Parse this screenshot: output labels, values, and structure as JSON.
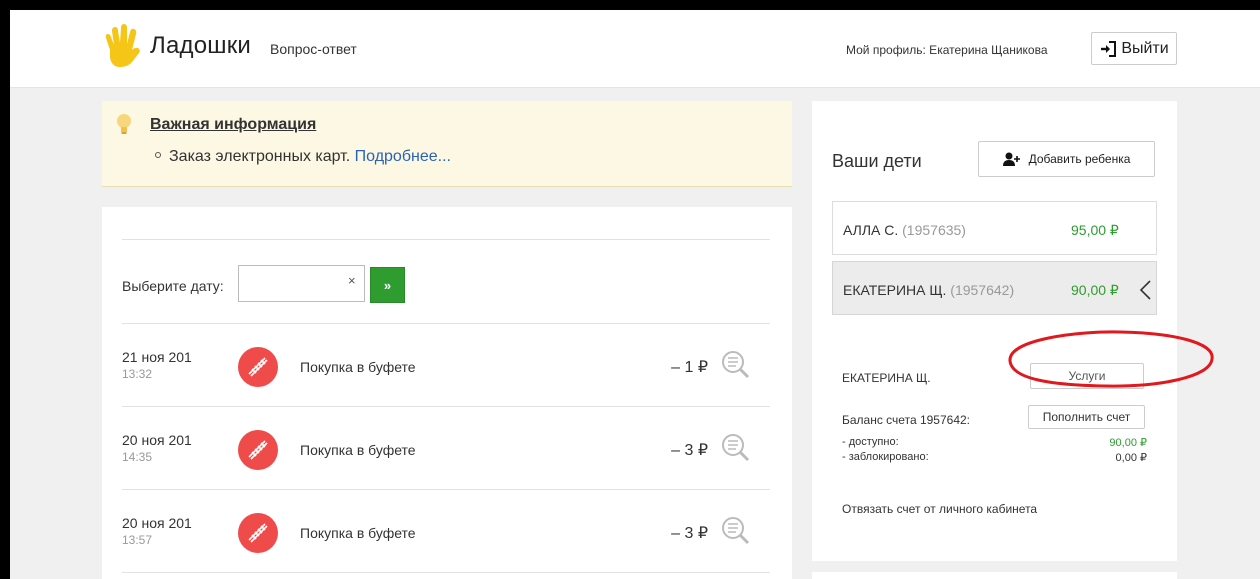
{
  "header": {
    "logo_text": "Ладошки",
    "nav_faq": "Вопрос-ответ",
    "profile_label": "Мой профиль: Екатерина Щаникова",
    "logout_label": "Выйти"
  },
  "notice": {
    "title": "Важная информация",
    "item_text": "Заказ электронных карт.",
    "item_link": "Подробнее..."
  },
  "feed": {
    "date_label": "Выберите дату:",
    "date_value": "",
    "clear_glyph": "×",
    "go_glyph": "»",
    "rows": [
      {
        "date": "21 ноя 201",
        "time": "13:32",
        "desc": "Покупка в буфете",
        "amount": "– 1 ₽"
      },
      {
        "date": "20 ноя 201",
        "time": "14:35",
        "desc": "Покупка в буфете",
        "amount": "– 3 ₽"
      },
      {
        "date": "20 ноя 201",
        "time": "13:57",
        "desc": "Покупка в буфете",
        "amount": "– 3 ₽"
      }
    ]
  },
  "sidebar": {
    "title": "Ваши дети",
    "add_child_label": "Добавить ребенка",
    "children": [
      {
        "name": "Алла С.",
        "account": "(1957635)",
        "balance": "95,00 ₽",
        "active": false
      },
      {
        "name": "Екатерина Щ.",
        "account": "(1957642)",
        "balance": "90,00 ₽",
        "active": true
      }
    ],
    "selected_name": "ЕКАТЕРИНА Щ.",
    "services_label": "Услуги",
    "balance_label": "Баланс счета 1957642:",
    "topup_label": "Пополнить счет",
    "available_label": "- доступно:",
    "available_value": "90,00 ₽",
    "blocked_label": "- заблокировано:",
    "blocked_value": "0,00 ₽",
    "unlink_label": "Отвязать счет от личного кабинета"
  },
  "colors": {
    "accent_green": "#2e9c2e",
    "notice_bg": "#fcf8e3",
    "link_blue": "#2a62b8",
    "badge_red": "#ef4b4b",
    "logo_yellow": "#f5c518",
    "annotation_red": "#e0191f"
  },
  "icons": {
    "logo": "waving-hand-icon",
    "logout": "sign-out-icon",
    "notice": "lightbulb-icon",
    "add_child": "add-user-icon",
    "row_badge": "cafeteria-purchase-icon",
    "row_detail": "magnifier-receipt-icon",
    "active_child": "chevron-left-icon"
  }
}
